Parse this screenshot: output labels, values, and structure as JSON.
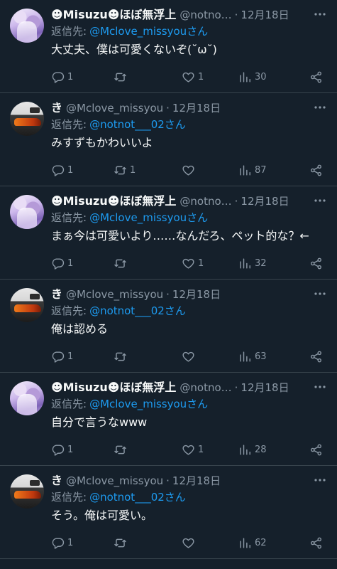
{
  "colors": {
    "background": "#15202b",
    "text": "#f7f9f9",
    "muted": "#8b98a5",
    "link": "#1d9bf0",
    "divider": "#38444d"
  },
  "reply_prefix": "返信先:",
  "tweets": [
    {
      "author": "misuzu",
      "name": "☻Misuzu☻ほぼ無浮上",
      "handle": "@notno…",
      "date": "12月18日",
      "reply_to": "@Mclove_missyouさん",
      "text": "大丈夫、僕は可愛くないぞ(˘ω˘)",
      "replies": "1",
      "retweets": "",
      "likes": "1",
      "views": "30"
    },
    {
      "author": "ki",
      "name": "き",
      "handle": "@Mclove_missyou",
      "date": "12月18日",
      "reply_to": "@notnot___02さん",
      "text": "みすずもかわいいよ",
      "replies": "1",
      "retweets": "1",
      "likes": "",
      "views": "87"
    },
    {
      "author": "misuzu",
      "name": "☻Misuzu☻ほぼ無浮上",
      "handle": "@notno…",
      "date": "12月18日",
      "reply_to": "@Mclove_missyouさん",
      "text": "まぁ今は可愛いより……なんだろ、ペット的な？←",
      "replies": "1",
      "retweets": "",
      "likes": "1",
      "views": "32"
    },
    {
      "author": "ki",
      "name": "き",
      "handle": "@Mclove_missyou",
      "date": "12月18日",
      "reply_to": "@notnot___02さん",
      "text": "俺は認める",
      "replies": "1",
      "retweets": "",
      "likes": "",
      "views": "63"
    },
    {
      "author": "misuzu",
      "name": "☻Misuzu☻ほぼ無浮上",
      "handle": "@notno…",
      "date": "12月18日",
      "reply_to": "@Mclove_missyouさん",
      "text": "自分で言うなwww",
      "replies": "1",
      "retweets": "",
      "likes": "1",
      "views": "28"
    },
    {
      "author": "ki",
      "name": "き",
      "handle": "@Mclove_missyou",
      "date": "12月18日",
      "reply_to": "@notnot___02さん",
      "text": "そう。俺は可愛い。",
      "replies": "1",
      "retweets": "",
      "likes": "",
      "views": "62"
    }
  ]
}
